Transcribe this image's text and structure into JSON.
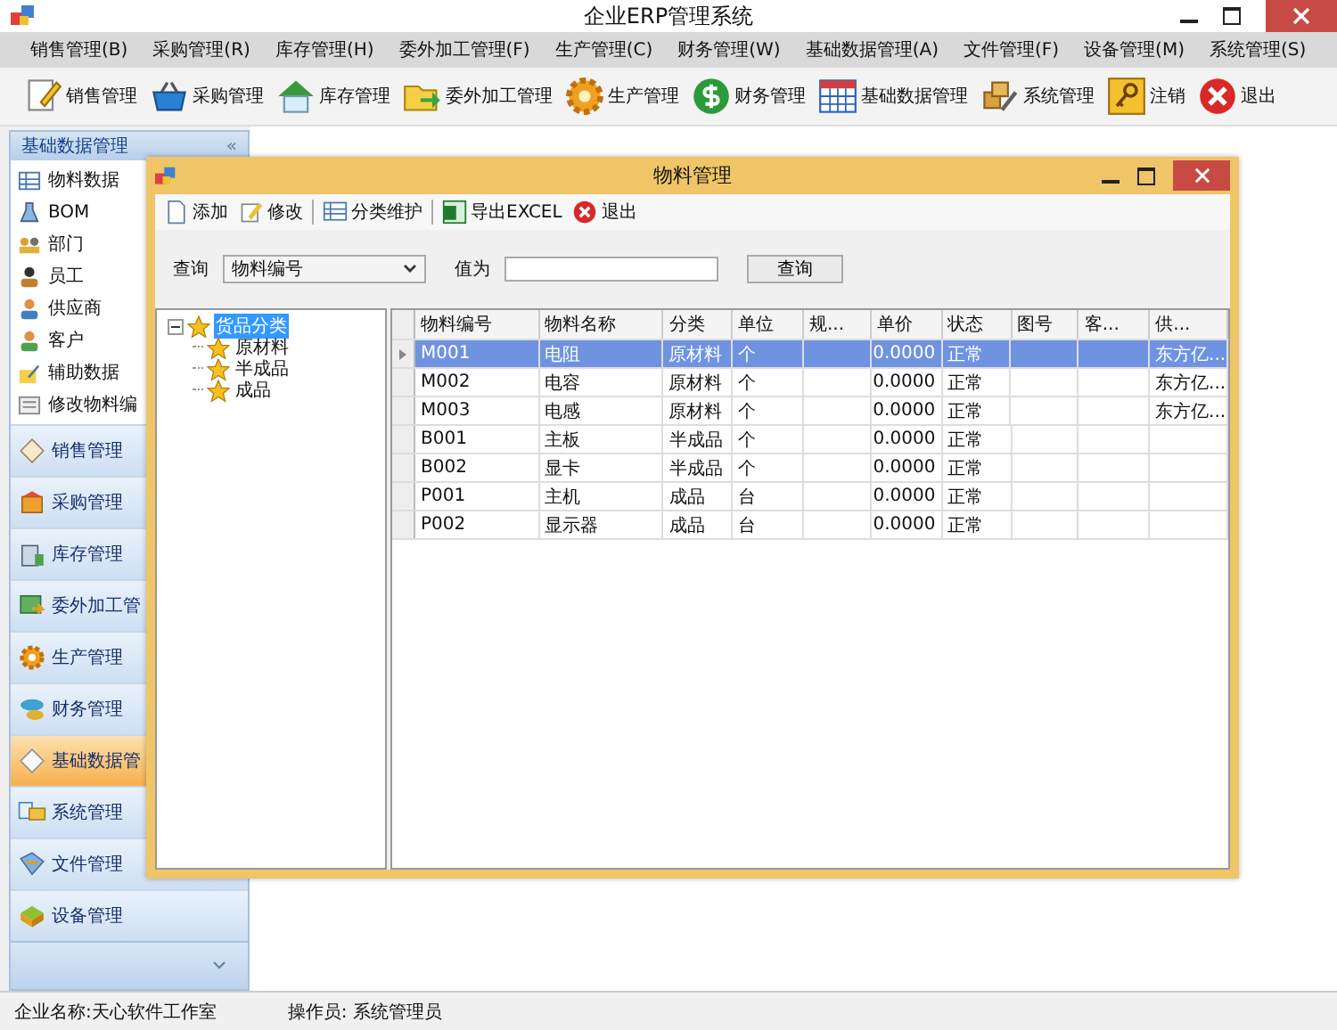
{
  "window": {
    "title": "企业ERP管理系统"
  },
  "menu": [
    {
      "label": "销售管理(B)"
    },
    {
      "label": "采购管理(R)"
    },
    {
      "label": "库存管理(H)"
    },
    {
      "label": "委外加工管理(F)"
    },
    {
      "label": "生产管理(C)"
    },
    {
      "label": "财务管理(W)"
    },
    {
      "label": "基础数据管理(A)"
    },
    {
      "label": "文件管理(F)"
    },
    {
      "label": "设备管理(M)"
    },
    {
      "label": "系统管理(S)"
    }
  ],
  "toolbar": [
    {
      "label": "销售管理"
    },
    {
      "label": "采购管理"
    },
    {
      "label": "库存管理"
    },
    {
      "label": "委外加工管理"
    },
    {
      "label": "生产管理"
    },
    {
      "label": "财务管理"
    },
    {
      "label": "基础数据管理"
    },
    {
      "label": "系统管理"
    },
    {
      "label": "注销"
    },
    {
      "label": "退出"
    }
  ],
  "sidebar": {
    "header": "基础数据管理",
    "collapse": "«",
    "items": [
      {
        "label": "物料数据"
      },
      {
        "label": "BOM"
      },
      {
        "label": "部门"
      },
      {
        "label": "员工"
      },
      {
        "label": "供应商"
      },
      {
        "label": "客户"
      },
      {
        "label": "辅助数据"
      },
      {
        "label": "修改物料编"
      }
    ],
    "nav": [
      {
        "label": "销售管理",
        "selected": false
      },
      {
        "label": "采购管理",
        "selected": false
      },
      {
        "label": "库存管理",
        "selected": false
      },
      {
        "label": "委外加工管",
        "selected": false
      },
      {
        "label": "生产管理",
        "selected": false
      },
      {
        "label": "财务管理",
        "selected": false
      },
      {
        "label": "基础数据管",
        "selected": true
      },
      {
        "label": "系统管理",
        "selected": false
      },
      {
        "label": "文件管理",
        "selected": false
      },
      {
        "label": "设备管理",
        "selected": false
      }
    ]
  },
  "child_window": {
    "title": "物料管理",
    "toolbar": [
      {
        "label": "添加"
      },
      {
        "label": "修改"
      },
      {
        "label": "分类维护"
      },
      {
        "label": "导出EXCEL"
      },
      {
        "label": "退出"
      }
    ],
    "query": {
      "label": "查询",
      "field": "物料编号",
      "value_label": "值为",
      "button": "查询"
    },
    "tree": {
      "label": "货品分类",
      "selected": true,
      "expanded": true,
      "children": [
        {
          "label": "原材料",
          "selected": false
        },
        {
          "label": "半成品",
          "selected": false
        },
        {
          "label": "成品",
          "selected": false
        }
      ]
    },
    "table": {
      "columns": [
        "物料编号",
        "物料名称",
        "分类",
        "单位",
        "规...",
        "单价",
        "状态",
        "图号",
        "客...",
        "供..."
      ],
      "rows": [
        {
          "cells": [
            "M001",
            "电阻",
            "原材料",
            "个",
            "",
            "0.0000",
            "正常",
            "",
            "",
            "东方亿..."
          ],
          "selected": true
        },
        {
          "cells": [
            "M002",
            "电容",
            "原材料",
            "个",
            "",
            "0.0000",
            "正常",
            "",
            "",
            "东方亿..."
          ],
          "selected": false
        },
        {
          "cells": [
            "M003",
            "电感",
            "原材料",
            "个",
            "",
            "0.0000",
            "正常",
            "",
            "",
            "东方亿..."
          ],
          "selected": false
        },
        {
          "cells": [
            "B001",
            "主板",
            "半成品",
            "个",
            "",
            "0.0000",
            "正常",
            "",
            "",
            ""
          ],
          "selected": false
        },
        {
          "cells": [
            "B002",
            "显卡",
            "半成品",
            "个",
            "",
            "0.0000",
            "正常",
            "",
            "",
            ""
          ],
          "selected": false
        },
        {
          "cells": [
            "P001",
            "主机",
            "成品",
            "台",
            "",
            "0.0000",
            "正常",
            "",
            "",
            ""
          ],
          "selected": false
        },
        {
          "cells": [
            "P002",
            "显示器",
            "成品",
            "台",
            "",
            "0.0000",
            "正常",
            "",
            "",
            ""
          ],
          "selected": false
        }
      ]
    }
  },
  "status_bar": [
    "企业名称:天心软件工作室",
    "操作员: 系统管理员"
  ]
}
